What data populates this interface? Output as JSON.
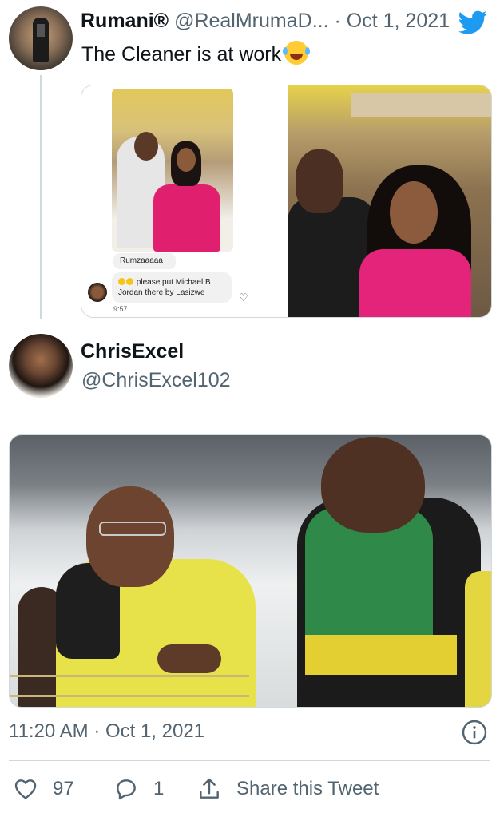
{
  "quoted_tweet": {
    "display_name": "Rumani®",
    "handle": "@RealMrumaD...",
    "separator": "·",
    "date": "Oct 1, 2021",
    "text": "The Cleaner is at work",
    "media": {
      "chat_message_1": "Rumzaaaaa",
      "chat_message_2_line1": "please put Michael B",
      "chat_message_2_line2": "Jordan there by Lasizwe",
      "chat_time": "9:57"
    }
  },
  "tweet": {
    "display_name": "ChrisExcel",
    "handle": "@ChrisExcel102",
    "timestamp": "11:20 AM · Oct 1, 2021",
    "actions": {
      "likes": "97",
      "replies": "1",
      "share_label": "Share this Tweet"
    }
  },
  "colors": {
    "twitter_blue": "#1d9bf0",
    "secondary_text": "#536471",
    "border": "#cfd9de"
  },
  "icons": [
    "twitter-bird-icon",
    "laughing-emoji-icon",
    "info-icon",
    "heart-icon",
    "reply-icon",
    "share-icon"
  ]
}
